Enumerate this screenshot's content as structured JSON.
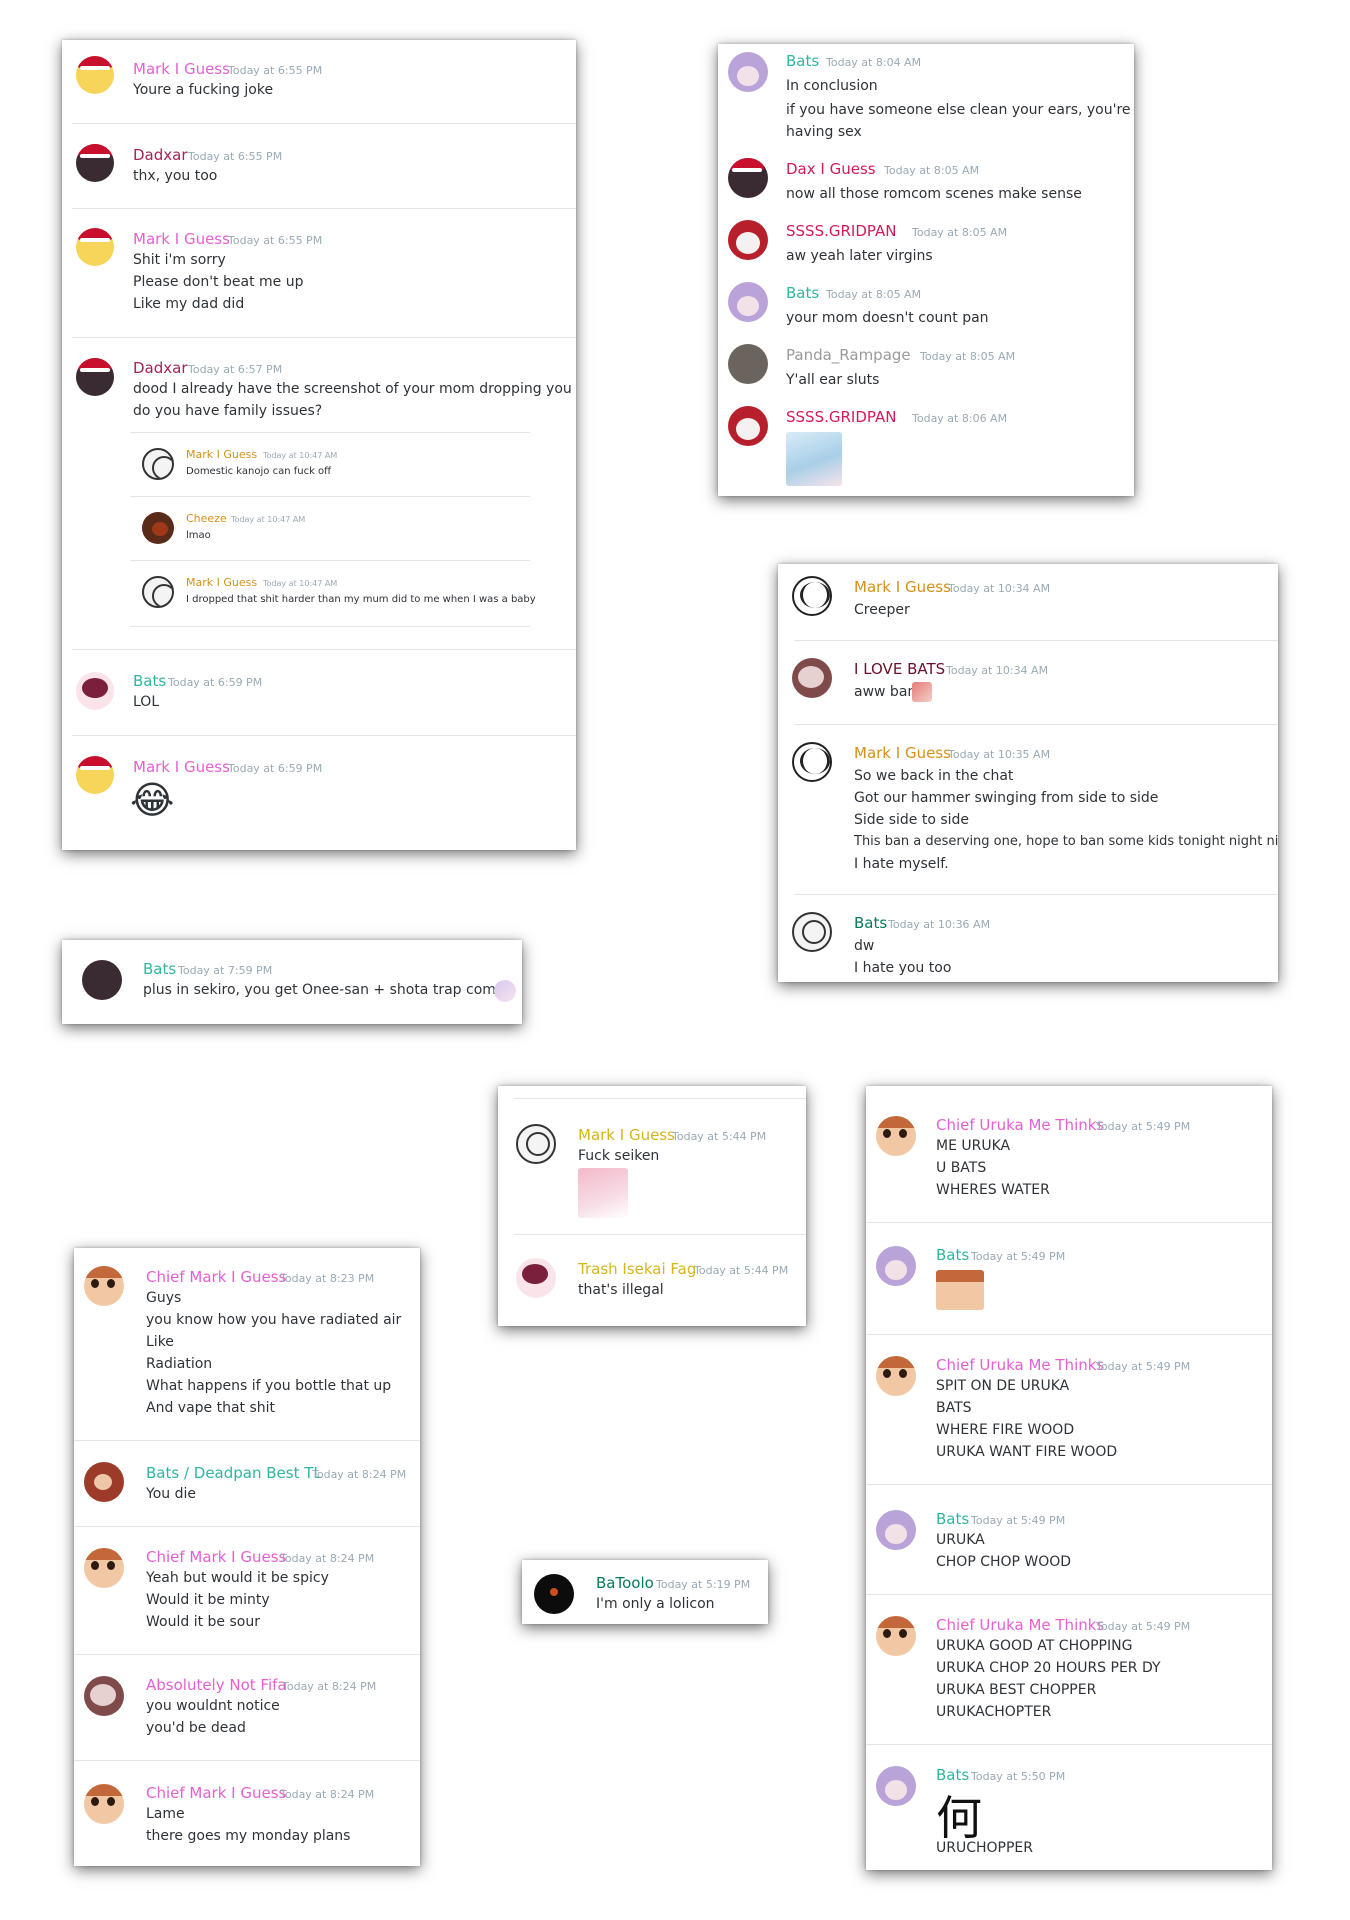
{
  "colors": {
    "pink": "#e660d0",
    "maroon": "#a4245a",
    "teal": "#2fb5a1",
    "gold": "#d4911a",
    "crimson": "#d4195a",
    "gray": "#9a9a9a",
    "darkred": "#6b0f2b",
    "bats_green": "#0a7a5c",
    "timestamp": "#99aab5"
  },
  "panel_a": {
    "messages": [
      {
        "name": "Mark I Guess",
        "time": "Today at 6:55 PM",
        "lines": [
          "Youre a fucking joke"
        ]
      },
      {
        "name": "Dadxar",
        "time": "Today at 6:55 PM",
        "lines": [
          "thx, you too"
        ]
      },
      {
        "name": "Mark I Guess",
        "time": "Today at 6:55 PM",
        "lines": [
          "Shit i'm sorry",
          "Please don't beat me up",
          "Like my dad did"
        ]
      },
      {
        "name": "Dadxar",
        "time": "Today at 6:57 PM",
        "lines": [
          "dood I already have the screenshot of your mom dropping you",
          "do you have family issues?"
        ]
      },
      {
        "name": "Bats",
        "time": "Today at 6:59 PM",
        "lines": [
          "LOL"
        ]
      },
      {
        "name": "Mark I Guess",
        "time": "Today at 6:59 PM",
        "emoji": "😂"
      }
    ],
    "embedded": [
      {
        "name": "Mark I Guess",
        "time": "Today at 10:47 AM",
        "line": "Domestic kanojo can fuck off"
      },
      {
        "name": "Cheeze",
        "time": "Today at 10:47 AM",
        "line": "lmao"
      },
      {
        "name": "Mark I Guess",
        "time": "Today at 10:47 AM",
        "line": "I dropped that shit harder than my mum did to me when I was a baby"
      }
    ]
  },
  "panel_b": {
    "messages": [
      {
        "name": "Bats",
        "time": "Today at 8:04 AM",
        "lines": [
          "In conclusion",
          "if you have someone else clean your ears, you're",
          "having sex"
        ]
      },
      {
        "name": "Dax I Guess",
        "time": "Today at 8:05 AM",
        "lines": [
          "now all those romcom scenes make sense"
        ]
      },
      {
        "name": "SSSS.GRIDPAN",
        "time": "Today at 8:05 AM",
        "lines": [
          "aw yeah later virgins"
        ]
      },
      {
        "name": "Bats",
        "time": "Today at 8:05 AM",
        "lines": [
          "your mom doesn't count pan"
        ]
      },
      {
        "name": "Panda_Rampage",
        "time": "Today at 8:05 AM",
        "lines": [
          "Y'all ear sluts"
        ]
      },
      {
        "name": "SSSS.GRIDPAN",
        "time": "Today at 8:06 AM",
        "lines": []
      }
    ]
  },
  "panel_c": {
    "messages": [
      {
        "name": "Mark I Guess",
        "time": "Today at 10:34 AM",
        "lines": [
          "Creeper"
        ]
      },
      {
        "name": "I LOVE BATS",
        "time": "Today at 10:34 AM",
        "lines": [
          "aww ban"
        ]
      },
      {
        "name": "Mark I Guess",
        "time": "Today at 10:35 AM",
        "lines": [
          "So we back in the chat",
          "Got our hammer swinging from side to side",
          "Side side to side",
          "This ban a deserving one, hope to ban some kids tonight night night",
          "I hate myself."
        ]
      },
      {
        "name": "Bats",
        "time": "Today at 10:36 AM",
        "lines": [
          "dw",
          "I hate you too"
        ]
      }
    ]
  },
  "panel_d": {
    "messages": [
      {
        "name": "Bats",
        "time": "Today at 7:59 PM",
        "lines": [
          "plus in sekiro, you get Onee-san + shota trap combo"
        ]
      }
    ]
  },
  "panel_e": {
    "messages": [
      {
        "name": "Mark I Guess",
        "time": "Today at 5:44 PM",
        "lines": [
          "Fuck seiken"
        ]
      },
      {
        "name": "Trash Isekai Fag",
        "time": "Today at 5:44 PM",
        "lines": [
          "that's illegal"
        ]
      }
    ]
  },
  "panel_f": {
    "messages": [
      {
        "name": "Chief Mark I Guess",
        "time": "Today at 8:23 PM",
        "lines": [
          "Guys",
          "you know how you have radiated air",
          "Like",
          "Radiation",
          "What happens if you bottle that up",
          "And vape that shit"
        ]
      },
      {
        "name": "Bats / Deadpan Best TL",
        "time": "Today at 8:24 PM",
        "lines": [
          "You die"
        ]
      },
      {
        "name": "Chief Mark I Guess",
        "time": "Today at 8:24 PM",
        "lines": [
          "Yeah but would it be spicy",
          "Would it be minty",
          "Would it be sour"
        ]
      },
      {
        "name": "Absolutely Not Fifa",
        "time": "Today at 8:24 PM",
        "lines": [
          "you wouldnt notice",
          "you'd be dead"
        ]
      },
      {
        "name": "Chief Mark I Guess",
        "time": "Today at 8:24 PM",
        "lines": [
          "Lame",
          "there goes my monday plans"
        ]
      }
    ]
  },
  "panel_g": {
    "messages": [
      {
        "name": "BaToolo",
        "time": "Today at 5:19 PM",
        "lines": [
          "I'm only a lolicon"
        ]
      }
    ]
  },
  "panel_h": {
    "messages": [
      {
        "name": "Chief Uruka Me Thinks",
        "time": "Today at 5:49 PM",
        "lines": [
          "ME URUKA",
          "U BATS",
          "WHERES WATER"
        ]
      },
      {
        "name": "Bats",
        "time": "Today at 5:49 PM",
        "lines": []
      },
      {
        "name": "Chief Uruka Me Thinks",
        "time": "Today at 5:49 PM",
        "lines": [
          "SPIT ON DE URUKA",
          "BATS",
          "WHERE FIRE WOOD",
          "URUKA WANT FIRE WOOD"
        ]
      },
      {
        "name": "Bats",
        "time": "Today at 5:49 PM",
        "lines": [
          "URUKA",
          "CHOP CHOP WOOD"
        ]
      },
      {
        "name": "Chief Uruka Me Thinks",
        "time": "Today at 5:49 PM",
        "lines": [
          "URUKA GOOD AT CHOPPING",
          "URUKA CHOP 20 HOURS PER DY",
          "URUKA BEST CHOPPER",
          "URUKACHOPTER"
        ]
      },
      {
        "name": "Bats",
        "time": "Today at 5:50 PM",
        "glyph": "何",
        "lines": [
          "URUCHOPPER"
        ]
      }
    ]
  }
}
